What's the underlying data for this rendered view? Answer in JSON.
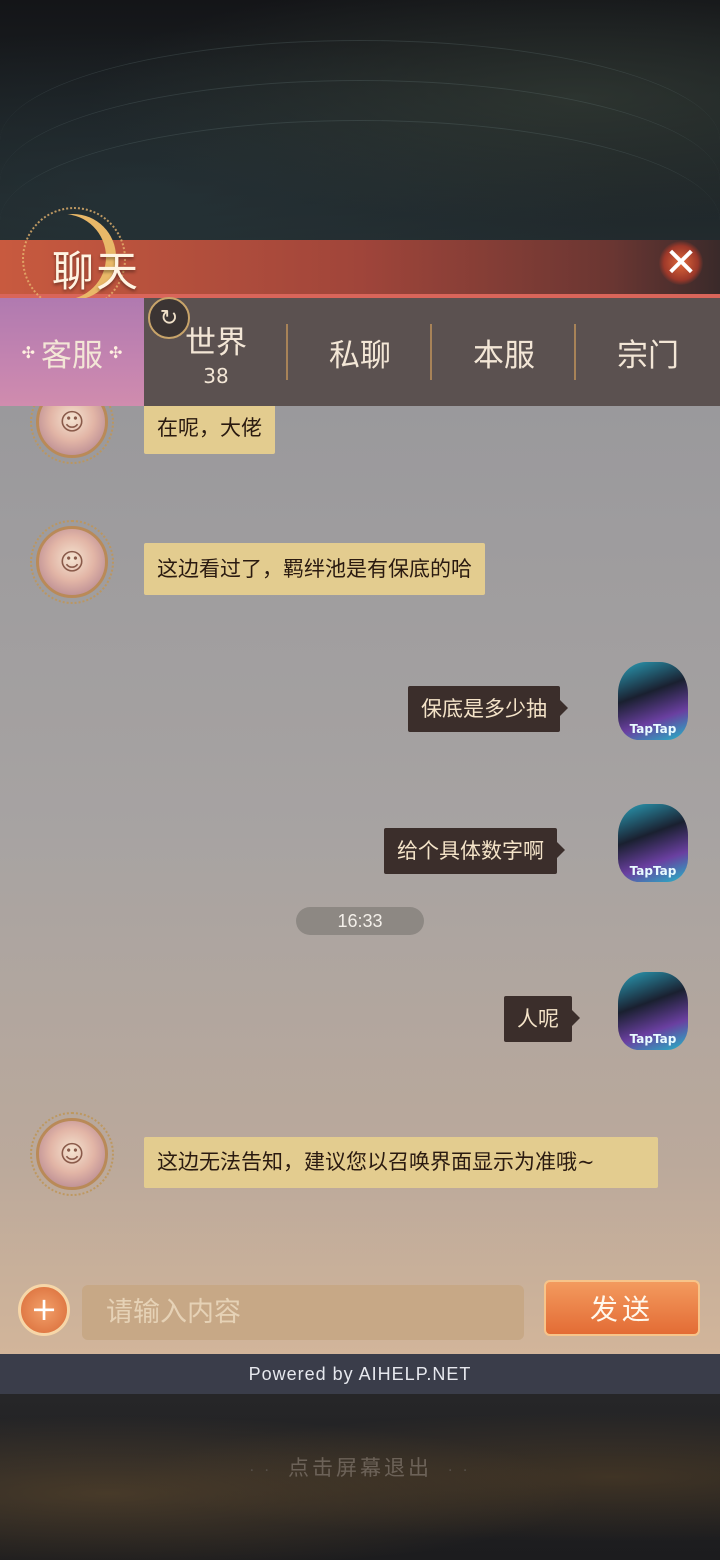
{
  "header": {
    "title": "聊天",
    "close_glyph": "✕"
  },
  "tabs": [
    {
      "label": "客服",
      "active": true,
      "decoration": "✣"
    },
    {
      "label": "世界",
      "count": "38"
    },
    {
      "label": "私聊"
    },
    {
      "label": "本服"
    },
    {
      "label": "宗门"
    }
  ],
  "refresh_glyph": "↻",
  "messages": [
    {
      "side": "left",
      "text": "在呢，大佬"
    },
    {
      "side": "left",
      "text": "这边看过了，羁绊池是有保底的哈"
    },
    {
      "side": "right",
      "text": "保底是多少抽"
    },
    {
      "side": "right",
      "text": "给个具体数字啊"
    },
    {
      "side": "right",
      "text": "人呢"
    },
    {
      "side": "left",
      "text": "这边无法告知，建议您以召唤界面显示为准哦~"
    }
  ],
  "time_badge": "16:33",
  "avatar_labels": {
    "user": "TapTap"
  },
  "input": {
    "placeholder": "请输入内容",
    "value": "",
    "plus_glyph": "+"
  },
  "send_label": "发送",
  "powered_by": "Powered by AIHELP.NET",
  "exit_hint": "点击屏幕退出",
  "exit_deco": "· ·",
  "colors": {
    "accent": "#e36c35",
    "header_red": "#c85a3f",
    "agent_bubble": "#e3cc8f",
    "user_bubble": "#3b2e2b",
    "active_tab": "#c484b0"
  },
  "icons": {
    "close": "close-icon",
    "refresh": "refresh-icon",
    "plus": "plus-icon",
    "agent_avatar": "support-agent-avatar",
    "user_avatar": "user-avatar"
  }
}
